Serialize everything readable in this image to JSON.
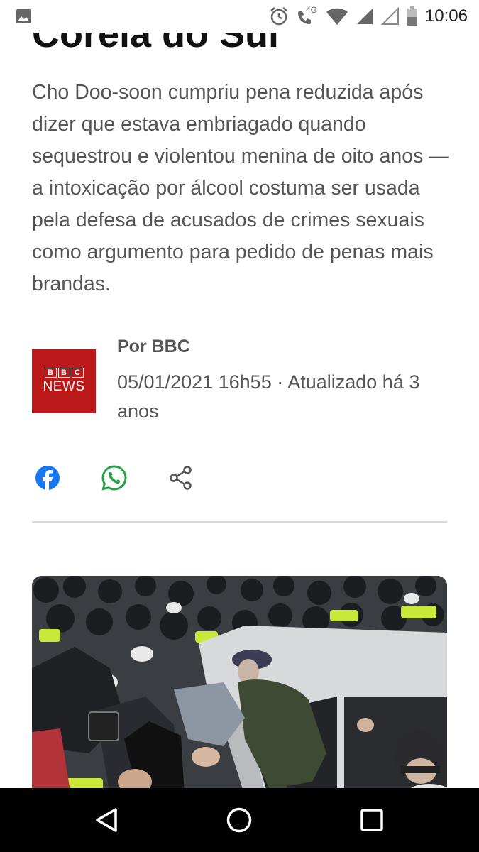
{
  "status_bar": {
    "time": "10:06",
    "network_label": "4G",
    "icons": [
      "image-icon",
      "alarm-icon",
      "call-4g-icon",
      "wifi-icon",
      "signal-icon",
      "signal-empty-icon",
      "battery-icon"
    ]
  },
  "article": {
    "headline_fragment": "Coreia do Sul",
    "summary": "Cho Doo-soon cumpriu pena reduzida após dizer que estava embriagado quando sequestrou e violentou menina de oito anos — a intoxicação por álcool costuma ser usada pela defesa de acusados de crimes sexuais como argumento para pedido de penas mais brandas.",
    "byline": {
      "author": "Por BBC",
      "date": "05/01/2021 16h55 · Atualizado há 3 anos",
      "logo": {
        "letters": [
          "B",
          "B",
          "C"
        ],
        "word": "NEWS",
        "color": "#bb1919"
      }
    },
    "share": {
      "icons": [
        "facebook-icon",
        "whatsapp-icon",
        "share-icon"
      ],
      "colors": {
        "facebook": "#1877f2",
        "whatsapp": "#25a244",
        "share": "#555555"
      }
    },
    "image": {
      "subject": "crowd-photo"
    }
  },
  "nav_bar": {
    "icons": [
      "back-icon",
      "home-icon",
      "recents-icon"
    ]
  }
}
